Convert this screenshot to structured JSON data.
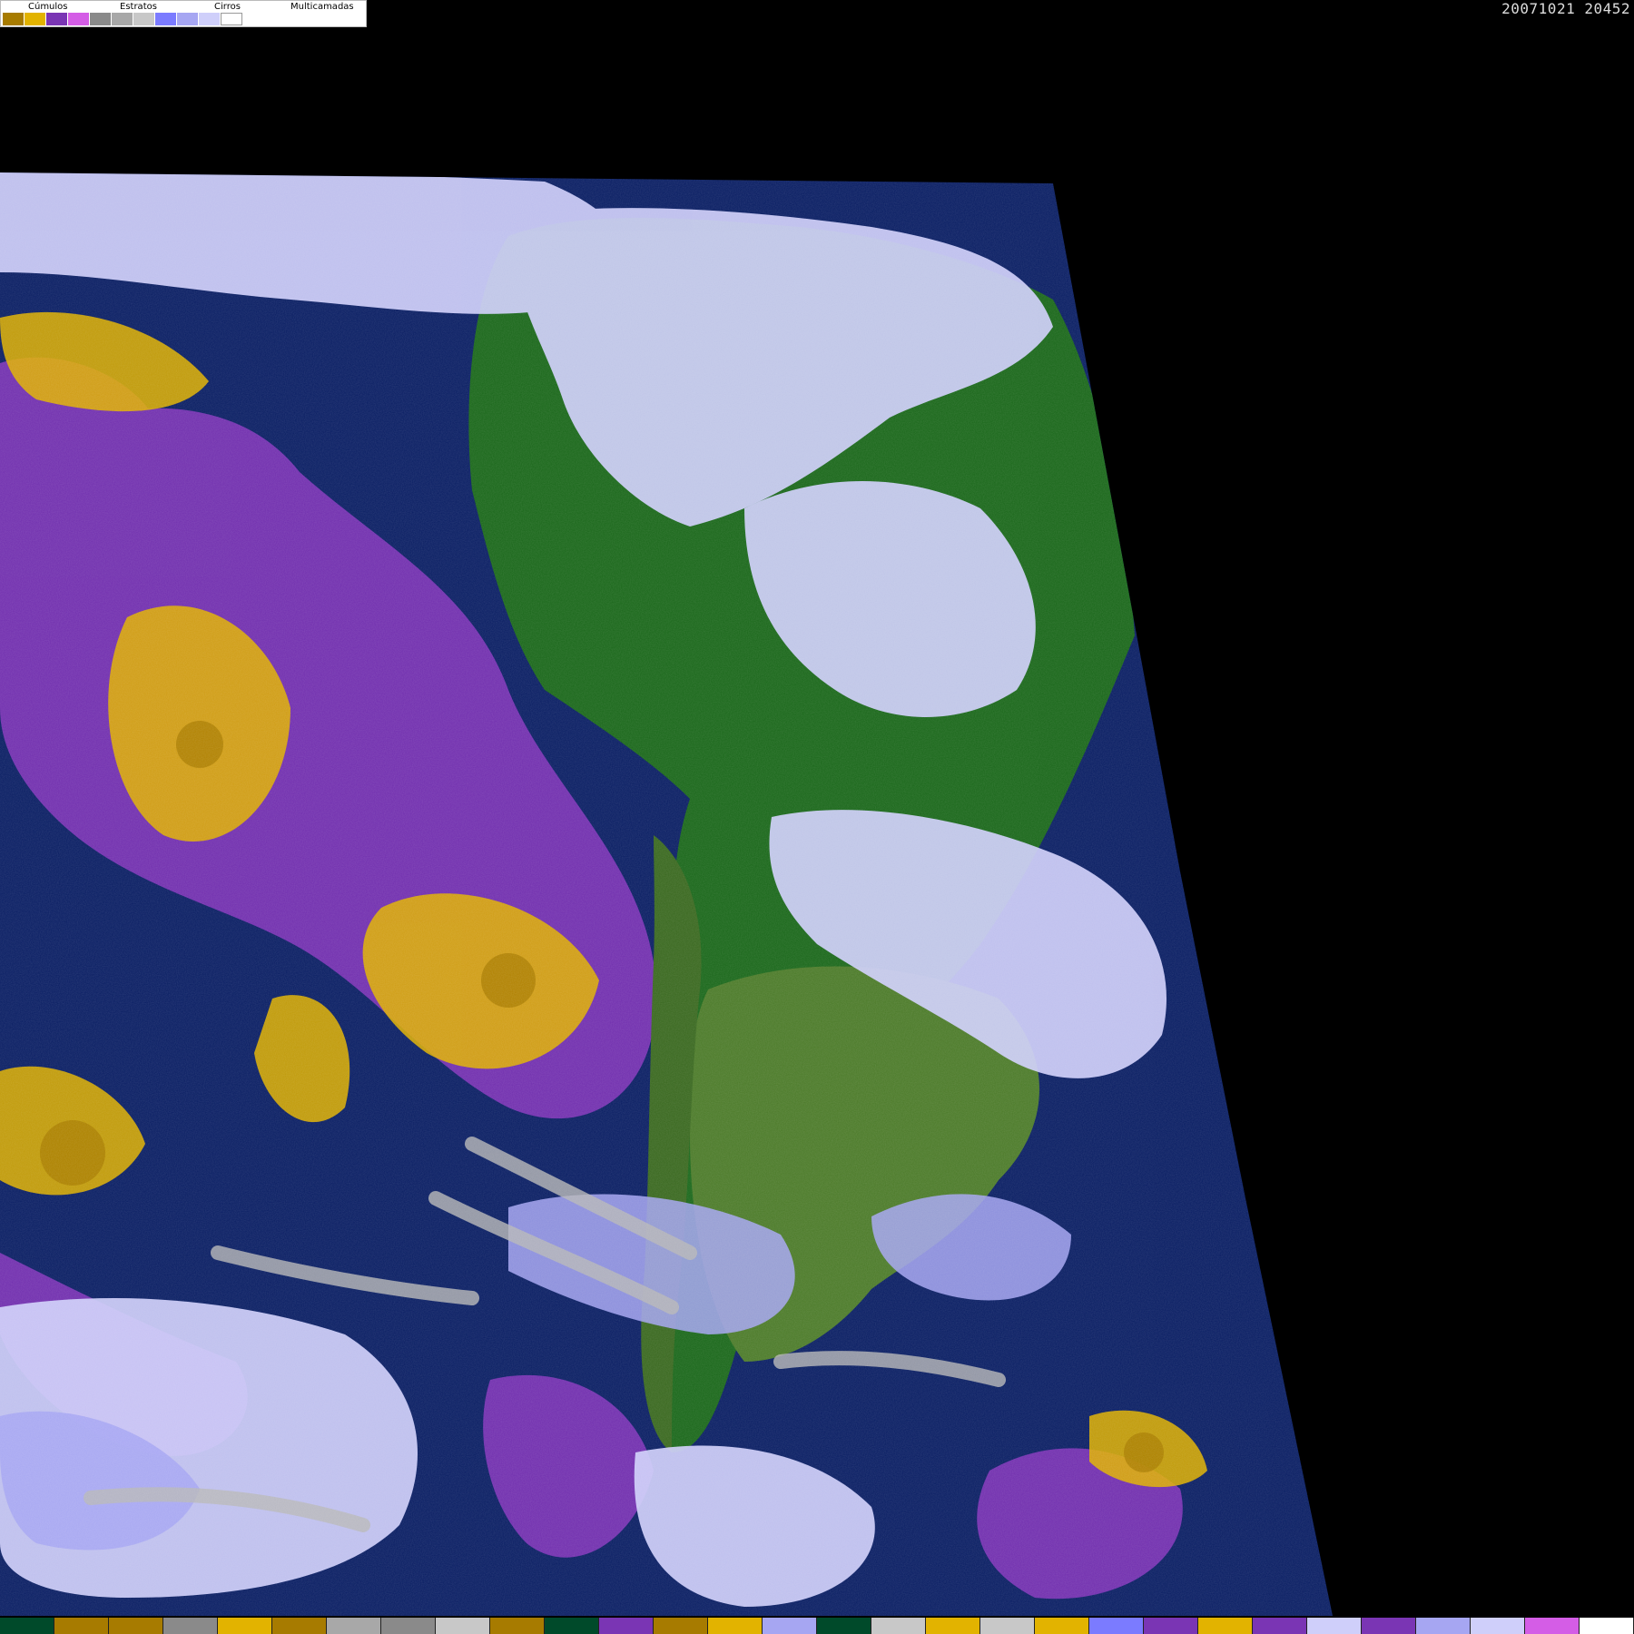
{
  "legend": {
    "groups": [
      {
        "label": "Cúmulos",
        "colors": [
          "#A77B00",
          "#E2B300"
        ]
      },
      {
        "label": "Estratos",
        "colors": [
          "#7A35B4",
          "#D45DE6"
        ]
      },
      {
        "label": "Cirros",
        "colors": [
          "#8A8A8A",
          "#A8A8A8",
          "#C8C8C8"
        ]
      },
      {
        "label": "Multicamadas",
        "colors": [
          "#7B7BFF",
          "#A6A6F2",
          "#CFCFFA"
        ]
      }
    ],
    "all_colors": [
      "#A77B00",
      "#E2B300",
      "#7A35B4",
      "#D45DE6",
      "#8A8A8A",
      "#A8A8A8",
      "#C8C8C8",
      "#7B7BFF",
      "#A6A6F2",
      "#CFCFFA",
      "#FFFFFF"
    ]
  },
  "timestamp": "20071021 20452",
  "colors": {
    "space": "#000000",
    "ocean": "#0E2266",
    "land_forest": "#1E6A1E",
    "land_grass": "#4F7D2D",
    "cumulus_dark": "#A77B00",
    "cumulus": "#E2B300",
    "stratus": "#7A35B4",
    "stratus_light": "#D45DE6",
    "cirrus": "#A8A8A8",
    "multilayer": "#A6A6F2",
    "multilayer_light": "#CFCFFA"
  },
  "palette_bar": [
    "#004A2A",
    "#A77B00",
    "#A77B00",
    "#8A8A8A",
    "#E2B300",
    "#A77B00",
    "#A8A8A8",
    "#8A8A8A",
    "#C8C8C8",
    "#A77B00",
    "#004A2A",
    "#7A35B4",
    "#A77B00",
    "#E2B300",
    "#A6A6F2",
    "#004A2A",
    "#C8C8C8",
    "#E2B300",
    "#C8C8C8",
    "#E2B300",
    "#7B7BFF",
    "#7A35B4",
    "#E2B300",
    "#7A35B4",
    "#CFCFFA",
    "#7A35B4",
    "#A6A6F2",
    "#CFCFFA",
    "#D45DE6",
    "#FFFFFF"
  ]
}
